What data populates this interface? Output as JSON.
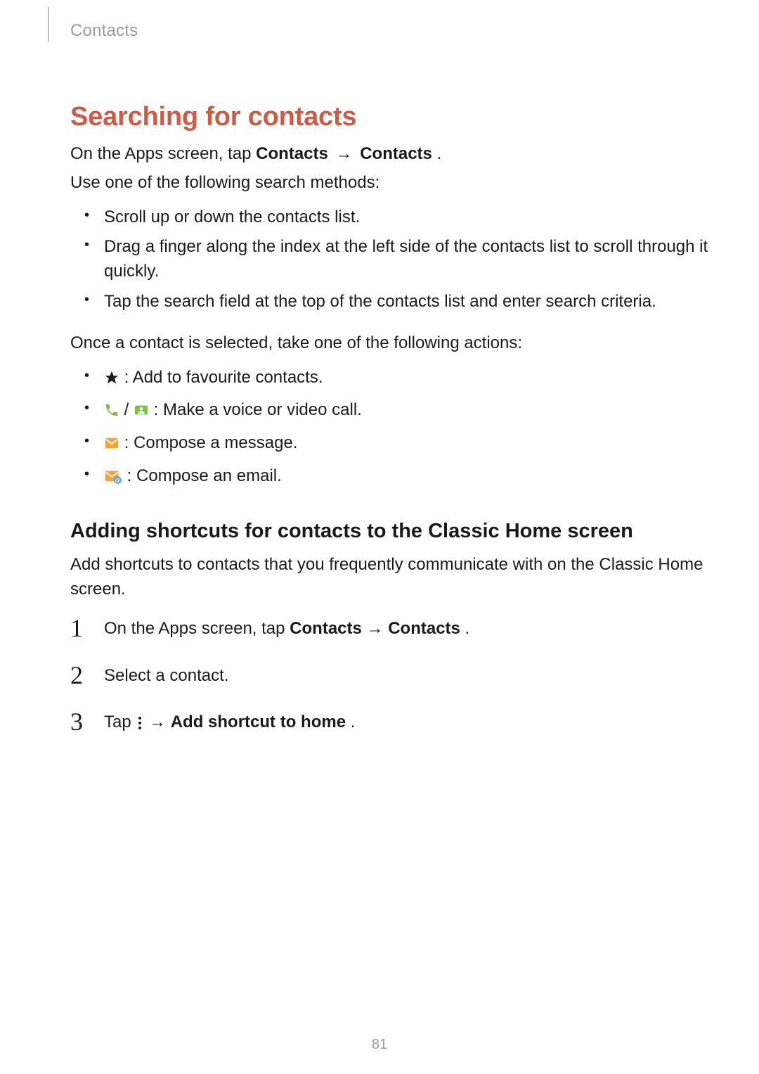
{
  "header": {
    "section": "Contacts"
  },
  "h2": "Searching for contacts",
  "intro": {
    "prefix": "On the Apps screen, tap ",
    "bold1": "Contacts",
    "arrow": " → ",
    "bold2": "Contacts",
    "suffix": "."
  },
  "intro2": "Use one of the following search methods:",
  "search_bullets": [
    "Scroll up or down the contacts list.",
    "Drag a finger along the index at the left side of the contacts list to scroll through it quickly.",
    "Tap the search field at the top of the contacts list and enter search criteria."
  ],
  "after_search": "Once a contact is selected, take one of the following actions:",
  "action_bullets": {
    "star": ": Add to favourite contacts.",
    "call_slash": " / ",
    "call": ": Make a voice or video call.",
    "msg": ": Compose a message.",
    "email": ": Compose an email."
  },
  "h3": "Adding shortcuts for contacts to the Classic Home screen",
  "shortcut_intro": "Add shortcuts to contacts that you frequently communicate with on the Classic Home screen.",
  "steps": {
    "n1": "1",
    "s1_prefix": "On the Apps screen, tap ",
    "s1_bold1": "Contacts",
    "s1_arrow": " → ",
    "s1_bold2": "Contacts",
    "s1_suffix": ".",
    "n2": "2",
    "s2": "Select a contact.",
    "n3": "3",
    "s3_prefix": "Tap ",
    "s3_arrow": " → ",
    "s3_bold": "Add shortcut to home",
    "s3_suffix": "."
  },
  "page_number": "81"
}
